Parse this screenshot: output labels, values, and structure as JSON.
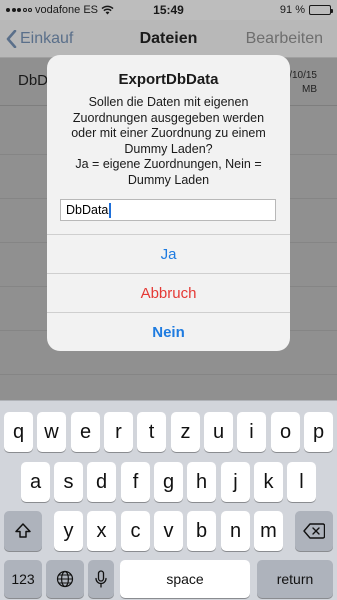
{
  "status_bar": {
    "carrier": "vodafone ES",
    "time": "15:49",
    "battery": "91 %",
    "battery_level": 0.91
  },
  "nav": {
    "back_label": "Einkauf",
    "title": "Dateien",
    "edit_label": "Bearbeiten"
  },
  "list": {
    "item_name_visible": "DbD",
    "item_date_visible": "/10/15",
    "item_size_visible": "MB"
  },
  "alert": {
    "title": "ExportDbData",
    "message_lines": [
      "Sollen die Daten mit eigenen",
      "Zuordnungen ausgegeben werden",
      "oder mit einer Zuordnung zu einem",
      "Dummy Laden?",
      "Ja = eigene Zuordnungen, Nein =",
      "Dummy Laden"
    ],
    "input_value": "DbData",
    "buttons": {
      "ja": "Ja",
      "abbruch": "Abbruch",
      "nein": "Nein"
    }
  },
  "keyboard": {
    "row1": [
      "q",
      "w",
      "e",
      "r",
      "t",
      "z",
      "u",
      "i",
      "o",
      "p"
    ],
    "row2": [
      "a",
      "s",
      "d",
      "f",
      "g",
      "h",
      "j",
      "k",
      "l"
    ],
    "row3": [
      "y",
      "x",
      "c",
      "v",
      "b",
      "n",
      "m"
    ],
    "numbers_label": "123",
    "space_label": "space",
    "return_label": "return",
    "icons": {
      "shift": "shift-icon",
      "delete": "delete-icon",
      "globe": "globe-icon",
      "mic": "microphone-icon"
    }
  }
}
